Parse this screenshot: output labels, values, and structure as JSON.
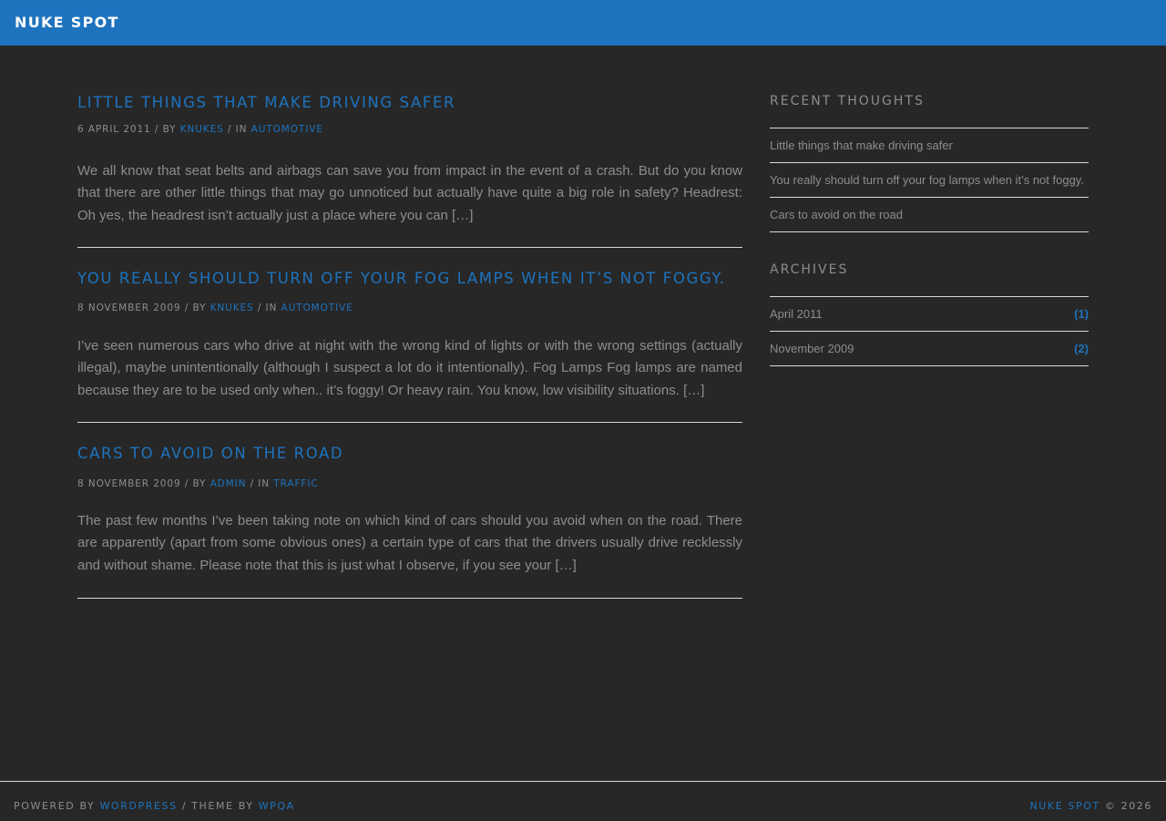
{
  "site": {
    "title": "NUKE SPOT"
  },
  "posts": [
    {
      "title": "LITTLE THINGS THAT MAKE DRIVING SAFER",
      "date": "6 APRIL 2011",
      "by_label": "/ BY",
      "author": "KNUKES",
      "in_label": "/ IN",
      "category": "AUTOMOTIVE",
      "excerpt": "We all know that seat belts and airbags can save you from impact in the event of a crash. But do you know that there are other little things that may go unnoticed but actually have quite a big role in safety? Headrest: Oh yes, the headrest isn’t actually just a place where you can […]"
    },
    {
      "title": "YOU REALLY SHOULD TURN OFF YOUR FOG LAMPS WHEN IT’S NOT FOGGY.",
      "date": "8 NOVEMBER 2009",
      "by_label": "/ BY",
      "author": "KNUKES",
      "in_label": "/ IN",
      "category": "AUTOMOTIVE",
      "excerpt": "I’ve seen numerous cars who drive at night with the wrong kind of lights or with the wrong settings (actually illegal), maybe unintentionally (although I suspect a lot do it intentionally). Fog Lamps Fog lamps are named because they are to be used only when.. it’s foggy! Or heavy rain. You know, low visibility situations. […]"
    },
    {
      "title": "CARS TO AVOID ON THE ROAD",
      "date": "8 NOVEMBER 2009",
      "by_label": "/ BY",
      "author": "ADMIN",
      "in_label": "/ IN",
      "category": "TRAFFIC",
      "excerpt": "The past few months I’ve been taking note on which kind of cars should you avoid when on the road. There are apparently (apart from some obvious ones) a certain type of cars that the drivers usually drive recklessly and without shame. Please note that this is just what I observe, if you see your […]"
    }
  ],
  "sidebar": {
    "recent": {
      "title": "RECENT THOUGHTS",
      "items": [
        "Little things that make driving safer",
        "You really should turn off your fog lamps when it’s not foggy.",
        "Cars to avoid on the road"
      ]
    },
    "archives": {
      "title": "ARCHIVES",
      "items": [
        {
          "label": "April 2011",
          "count": "(1)"
        },
        {
          "label": "November 2009",
          "count": "(2)"
        }
      ]
    }
  },
  "footer": {
    "powered_label": "POWERED BY",
    "wordpress": "WORDPRESS",
    "theme_label": "/ THEME BY",
    "wpqa": "WPQA",
    "site_link": "NUKE SPOT",
    "copyright": "© 2026"
  },
  "colors": {
    "accent": "#1e73be",
    "background": "#272727",
    "text": "#8d8d8d",
    "divider": "#d8d8d8"
  }
}
